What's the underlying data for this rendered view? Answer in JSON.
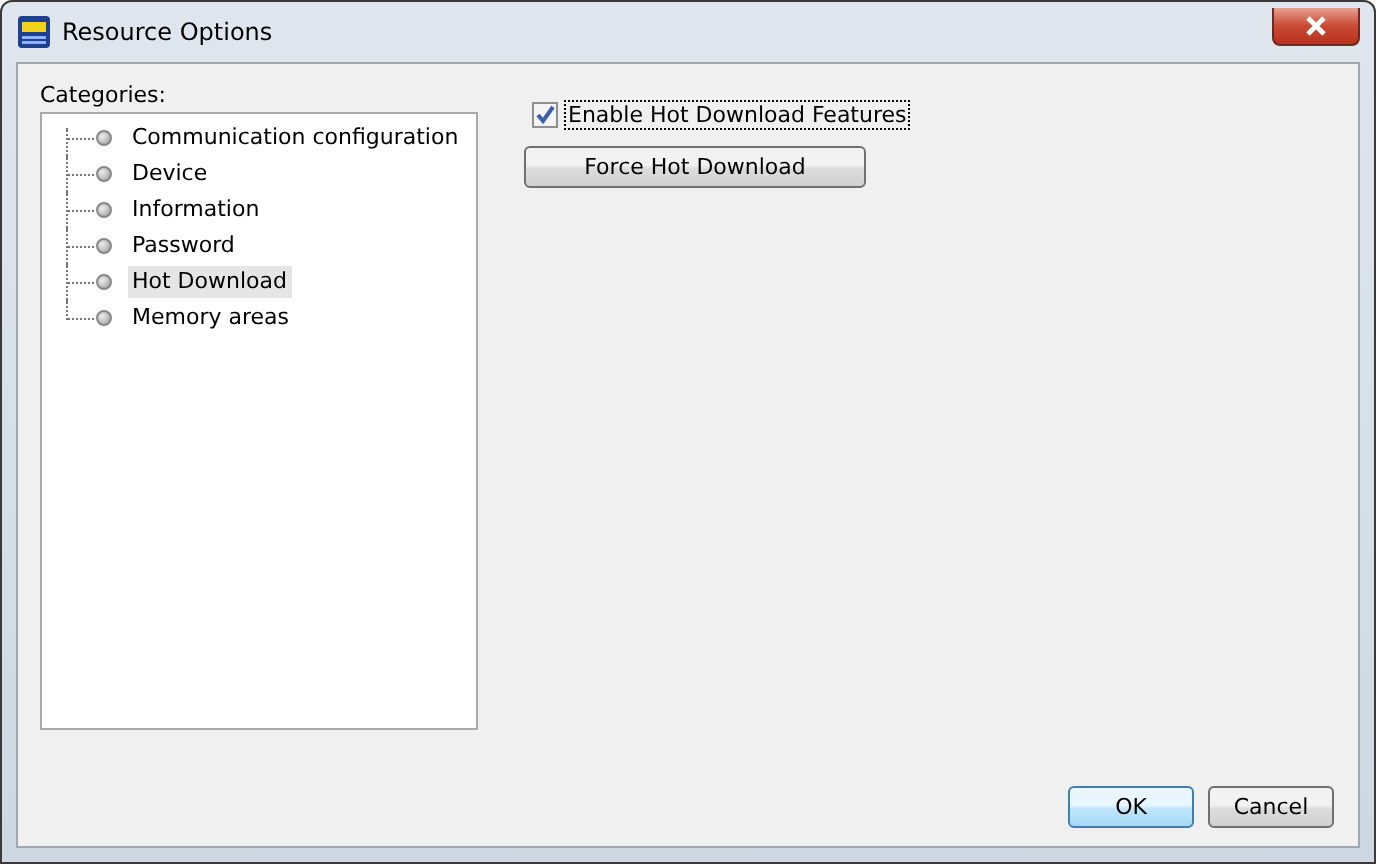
{
  "window": {
    "title": "Resource Options"
  },
  "categories": {
    "label": "Categories:",
    "items": [
      {
        "label": "Communication configuration",
        "selected": false
      },
      {
        "label": "Device",
        "selected": false
      },
      {
        "label": "Information",
        "selected": false
      },
      {
        "label": "Password",
        "selected": false
      },
      {
        "label": "Hot Download",
        "selected": true
      },
      {
        "label": "Memory areas",
        "selected": false
      }
    ]
  },
  "enable_checkbox": {
    "label": "Enable Hot Download Features",
    "checked": true
  },
  "force_button": {
    "label": "Force Hot Download"
  },
  "buttons": [
    {
      "label": "OK",
      "kind": "default"
    },
    {
      "label": "Cancel",
      "kind": "normal"
    }
  ]
}
